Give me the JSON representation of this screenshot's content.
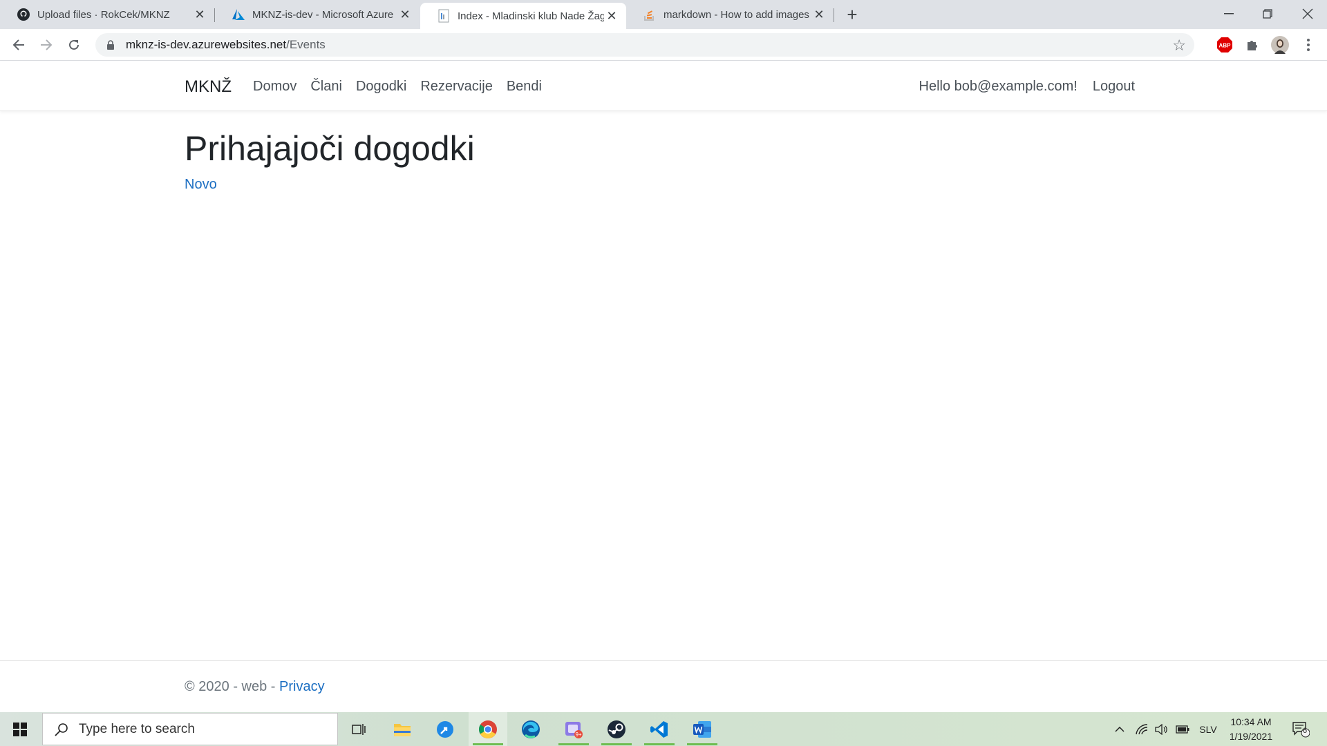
{
  "browser": {
    "tabs": [
      {
        "title": "Upload files · RokCek/MKNZ",
        "icon": "github-icon"
      },
      {
        "title": "MKNZ-is-dev - Microsoft Azure",
        "icon": "azure-icon"
      },
      {
        "title": "Index - Mladinski klub Nade Žagar",
        "icon": "page-icon"
      },
      {
        "title": "markdown - How to add images",
        "icon": "stackoverflow-icon"
      }
    ],
    "url_host": "mknz-is-dev.azurewebsites.net",
    "url_path": "/Events",
    "abp_label": "ABP"
  },
  "site": {
    "brand": "MKNŽ",
    "nav": [
      "Domov",
      "Člani",
      "Dogodki",
      "Rezervacije",
      "Bendi"
    ],
    "greeting": "Hello bob@example.com!",
    "logout": "Logout",
    "title": "Prihajajoči dogodki",
    "new_link": "Novo",
    "footer_text": "© 2020 - web - ",
    "footer_link": "Privacy"
  },
  "taskbar": {
    "search_placeholder": "Type here to search",
    "language": "SLV",
    "time": "10:34 AM",
    "date": "1/19/2021",
    "notifications": "6"
  },
  "colors": {
    "link": "#1b6ec2",
    "tabstrip": "#dee1e6",
    "running_indicator": "#6fbd52"
  }
}
